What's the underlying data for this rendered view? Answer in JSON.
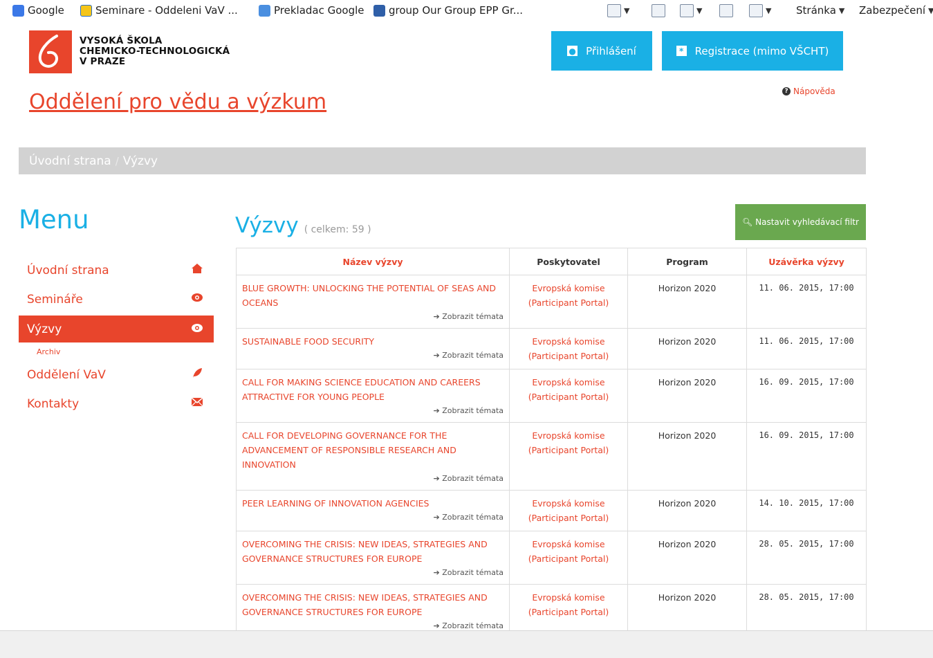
{
  "browser": {
    "favorites": [
      {
        "label": "Google",
        "icon": "google-icon"
      },
      {
        "label": "Seminare - Oddeleni VaV ...",
        "icon": "ie-page-icon"
      },
      {
        "label": "Prekladac Google",
        "icon": "translate-icon"
      },
      {
        "label": "group  Our Group  EPP Gr...",
        "icon": "group-icon"
      }
    ],
    "commands": {
      "page": "Stránka",
      "security": "Zabezpečení"
    }
  },
  "header": {
    "school_line1": "VYSOKÁ ŠKOLA",
    "school_line2": "CHEMICKO-TECHNOLOGICKÁ",
    "school_line3": "V PRAZE",
    "login_label": "Přihlášení",
    "register_label": "Registrace (mimo VŠCHT)",
    "help_label": "Nápověda",
    "department": "Oddělení pro vědu a výzkum"
  },
  "breadcrumb": {
    "home": "Úvodní strana",
    "separator": "/",
    "current": "Výzvy"
  },
  "sidebar": {
    "title": "Menu",
    "items": [
      {
        "label": "Úvodní strana",
        "icon": "home-icon"
      },
      {
        "label": "Semináře",
        "icon": "eye-icon"
      },
      {
        "label": "Výzvy",
        "icon": "eye-icon",
        "active": true
      },
      {
        "label": "Archiv",
        "sub": true
      },
      {
        "label": "Oddělení VaV",
        "icon": "leaf-icon"
      },
      {
        "label": "Kontakty",
        "icon": "envelope-icon"
      }
    ]
  },
  "main": {
    "title": "Výzvy",
    "count": "( celkem: 59 )",
    "filter_button": "Nastavit vyhledávací filtr",
    "columns": [
      "Název výzvy",
      "Poskytovatel",
      "Program",
      "Uzávěrka výzvy"
    ],
    "rows": [
      {
        "name": "BLUE GROWTH: UNLOCKING THE POTENTIAL OF SEAS AND OCEANS",
        "topics": "Zobrazit témata",
        "provider": "Evropská komise (Participant Portal)",
        "program": "Horizon 2020",
        "deadline": "11. 06. 2015, 17:00"
      },
      {
        "name": "SUSTAINABLE FOOD SECURITY",
        "topics": "Zobrazit témata",
        "provider": "Evropská komise (Participant Portal)",
        "program": "Horizon 2020",
        "deadline": "11. 06. 2015, 17:00"
      },
      {
        "name": "CALL FOR MAKING SCIENCE EDUCATION AND CAREERS ATTRACTIVE FOR YOUNG PEOPLE",
        "topics": "Zobrazit témata",
        "provider": "Evropská komise (Participant Portal)",
        "program": "Horizon 2020",
        "deadline": "16. 09. 2015, 17:00"
      },
      {
        "name": "CALL FOR DEVELOPING GOVERNANCE FOR THE ADVANCEMENT OF RESPONSIBLE RESEARCH AND INNOVATION",
        "topics": "Zobrazit témata",
        "provider": "Evropská komise (Participant Portal)",
        "program": "Horizon 2020",
        "deadline": "16. 09. 2015, 17:00"
      },
      {
        "name": "PEER LEARNING OF INNOVATION AGENCIES",
        "topics": "Zobrazit témata",
        "provider": "Evropská komise (Participant Portal)",
        "program": "Horizon 2020",
        "deadline": "14. 10. 2015, 17:00"
      },
      {
        "name": "OVERCOMING THE CRISIS: NEW IDEAS, STRATEGIES AND GOVERNANCE STRUCTURES FOR EUROPE",
        "topics": "Zobrazit témata",
        "provider": "Evropská komise (Participant Portal)",
        "program": "Horizon 2020",
        "deadline": "28. 05. 2015, 17:00"
      },
      {
        "name": "OVERCOMING THE CRISIS: NEW IDEAS, STRATEGIES AND GOVERNANCE STRUCTURES FOR EUROPE",
        "topics": "Zobrazit témata",
        "provider": "Evropská komise (Participant Portal)",
        "program": "Horizon 2020",
        "deadline": "28. 05. 2015, 17:00"
      }
    ]
  },
  "colors": {
    "accent_red": "#e8452c",
    "accent_blue": "#1ab0e5",
    "filter_green": "#6aa84f",
    "breadcrumb_gray": "#d2d2d2"
  }
}
